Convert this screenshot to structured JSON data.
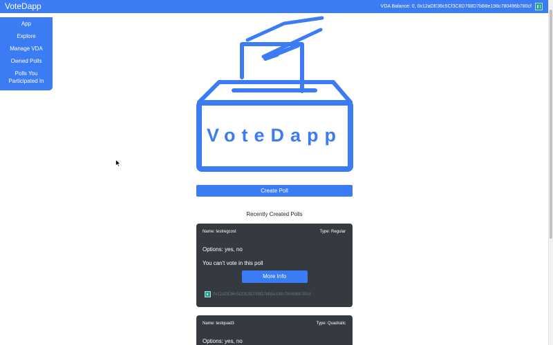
{
  "header": {
    "brand": "VoteDapp",
    "balance_text": "VDA Balance: 0, 0x12aDE36c5Cf3C8D768D7bB8e198c780496b780cf"
  },
  "sidebar": {
    "items": [
      {
        "label": "App"
      },
      {
        "label": "Explore"
      },
      {
        "label": "Manage VDA"
      },
      {
        "label": "Owned Polls"
      },
      {
        "label": "Polls You Participated In"
      }
    ]
  },
  "logo": {
    "title": "VoteDapp"
  },
  "create_button": "Create Poll",
  "recent_title": "Recently Created Polls",
  "polls": [
    {
      "name": "Name: testregcost",
      "type": "Type: Regular",
      "options": "Options: yes, no",
      "note": "You can't vote in this poll",
      "more_label": "More Info",
      "owner": "0x12aDE36c5Cf3C8D768D7bB8e198c780496b780cf"
    },
    {
      "name": "Name: testquad3",
      "type": "Type: Quadratic",
      "options": "Options: yes, no"
    }
  ],
  "colors": {
    "accent": "#3b7cf5",
    "card": "#343a40"
  }
}
